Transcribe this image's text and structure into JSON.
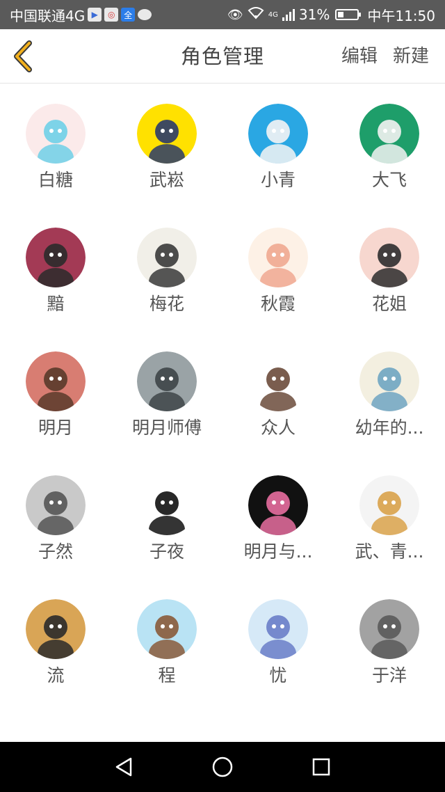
{
  "status_bar": {
    "carrier": "中国联通4G",
    "network": "4G",
    "battery": "31%",
    "battery_level": 0.31,
    "time": "中午11:50"
  },
  "nav": {
    "title": "角色管理",
    "edit_label": "编辑",
    "new_label": "新建"
  },
  "theme": {
    "accent": "#f2b01e",
    "text": "#555555"
  },
  "characters": [
    {
      "name": "白糖",
      "bg": "#fbeaea",
      "fg": "#6fd0e8"
    },
    {
      "name": "武崧",
      "bg": "#ffe100",
      "fg": "#2a3a6a"
    },
    {
      "name": "小青",
      "bg": "#2aa7e3",
      "fg": "#f4f4f4"
    },
    {
      "name": "大飞",
      "bg": "#1e9e6a",
      "fg": "#f2f2f2"
    },
    {
      "name": "黯",
      "bg": "#a33a55",
      "fg": "#2b2b2b"
    },
    {
      "name": "梅花",
      "bg": "#f1efe8",
      "fg": "#3a3a3a"
    },
    {
      "name": "秋霞",
      "bg": "#fdf1e6",
      "fg": "#f0a890"
    },
    {
      "name": "花姐",
      "bg": "#f7d7cf",
      "fg": "#2d2d2d"
    },
    {
      "name": "明月",
      "bg": "#d87d72",
      "fg": "#5a3a2a"
    },
    {
      "name": "明月师傅",
      "bg": "#9aa3a6",
      "fg": "#3e4548"
    },
    {
      "name": "众人",
      "bg": "#ffffff",
      "fg": "#6b4b3b"
    },
    {
      "name": "幼年的...",
      "bg": "#f3efe0",
      "fg": "#6fa5c2"
    },
    {
      "name": "子然",
      "bg": "#c9c9c9",
      "fg": "#555555"
    },
    {
      "name": "子夜",
      "bg": "#ffffff",
      "fg": "#111111"
    },
    {
      "name": "明月与...",
      "bg": "#111111",
      "fg": "#e86ea0"
    },
    {
      "name": "武、青...",
      "bg": "#f4f4f4",
      "fg": "#d9a24a"
    },
    {
      "name": "流",
      "bg": "#d9a556",
      "fg": "#2a2a2a"
    },
    {
      "name": "程",
      "bg": "#b9e3f4",
      "fg": "#8a5a3a"
    },
    {
      "name": "忧",
      "bg": "#d6e9f7",
      "fg": "#6a7ec8"
    },
    {
      "name": "于洋",
      "bg": "#a2a2a2",
      "fg": "#5a5a5a"
    }
  ]
}
